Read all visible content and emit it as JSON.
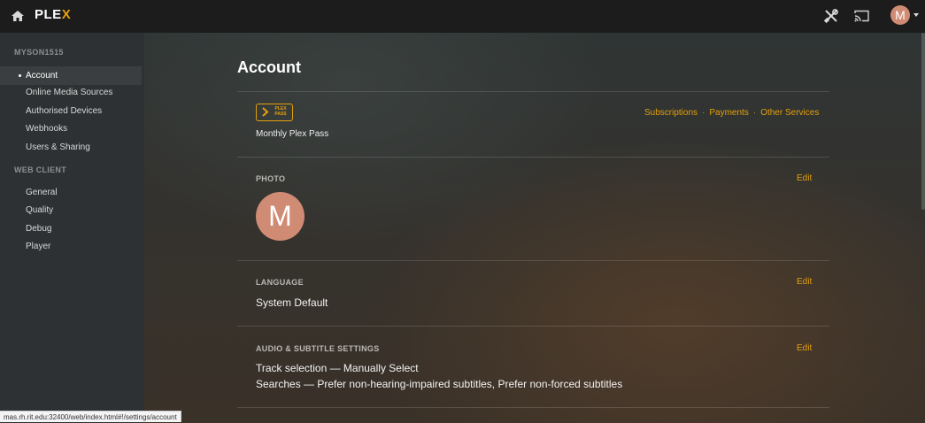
{
  "topbar": {
    "logo_text": "PLE",
    "logo_accent": "X",
    "icons": [
      "home-icon",
      "tools-icon",
      "cast-icon"
    ],
    "user_initial": "M"
  },
  "sidebar": {
    "account_heading": "MYSON1515",
    "account_items": [
      {
        "label": "Account",
        "active": true
      },
      {
        "label": "Online Media Sources"
      },
      {
        "label": "Authorised Devices"
      },
      {
        "label": "Webhooks"
      },
      {
        "label": "Users & Sharing"
      }
    ],
    "client_heading": "WEB CLIENT",
    "client_items": [
      {
        "label": "General"
      },
      {
        "label": "Quality"
      },
      {
        "label": "Debug"
      },
      {
        "label": "Player"
      }
    ]
  },
  "main": {
    "title": "Account",
    "plexpass": {
      "badge_top": "PLEX",
      "badge_bottom": "PASS",
      "plan": "Monthly Plex Pass",
      "links": [
        "Subscriptions",
        "Payments",
        "Other Services"
      ],
      "separator": "·"
    },
    "photo": {
      "label": "PHOTO",
      "edit": "Edit",
      "initial": "M"
    },
    "language": {
      "label": "LANGUAGE",
      "edit": "Edit",
      "value": "System Default"
    },
    "audio": {
      "label": "AUDIO & SUBTITLE SETTINGS",
      "edit": "Edit",
      "line1": "Track selection — Manually Select",
      "line2": "Searches — Prefer non-hearing-impaired subtitles, Prefer non-forced subtitles"
    }
  },
  "statusbar": {
    "url": "mas.rh.rit.edu:32400/web/index.html#!/settings/account"
  },
  "colors": {
    "accent": "#e5a00d",
    "avatar": "#cf8b73",
    "topbar": "#1c1c1c",
    "sidebar": "#2e3133"
  }
}
